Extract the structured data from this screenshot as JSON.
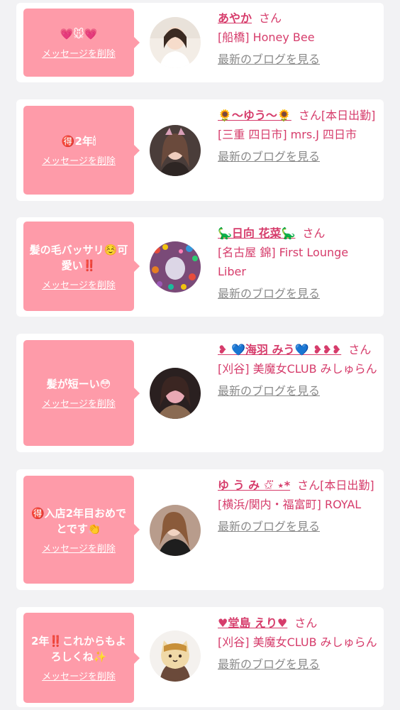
{
  "cards": [
    {
      "message": "💗🐭💗",
      "delete_label": "メッセージを削除",
      "name": "あやか",
      "san": "さん",
      "shop": "[船橋] Honey Bee",
      "blog_link": "最新のブログを見る"
    },
    {
      "message": "🉐2年🕯",
      "delete_label": "メッセージを削除",
      "name": "🌻〜ゆう〜🌻",
      "san": "さん[本日出勤]",
      "shop": "[三重 四日市] mrs.J 四日市",
      "blog_link": "最新のブログを見る"
    },
    {
      "message": "髪の毛バッサリ☺️可愛い‼️",
      "delete_label": "メッセージを削除",
      "name": "🦕日向 花菜🦕",
      "san": "さん",
      "shop": "[名古屋 錦] First Lounge Liber",
      "blog_link": "最新のブログを見る"
    },
    {
      "message": "髪が短ーい😳",
      "delete_label": "メッセージを削除",
      "name": "❥ 💙海羽 みう💙 ❥❥❥",
      "san": "さん",
      "shop": "[刈谷] 美魔女CLUB みしゅらん",
      "blog_link": "最新のブログを見る"
    },
    {
      "message": "🉐入店2年目おめでとです👏",
      "delete_label": "メッセージを削除",
      "name": "ゆ う み ✩⃛  ⋆*",
      "san": "さん[本日出勤]",
      "shop": "[横浜/関内・福富町] ROYAL",
      "blog_link": "最新のブログを見る"
    },
    {
      "message": "2年‼️これからもよろしくね✨",
      "delete_label": "メッセージを削除",
      "name": "♥堂島 えり♥",
      "san": "さん",
      "shop": "[刈谷] 美魔女CLUB みしゅらん",
      "blog_link": "最新のブログを見る"
    }
  ],
  "colors": {
    "page_bg": "#f2f2f4",
    "bubble": "#fe9ba9",
    "name": "#d63c6b",
    "link": "#8a8a8a"
  }
}
